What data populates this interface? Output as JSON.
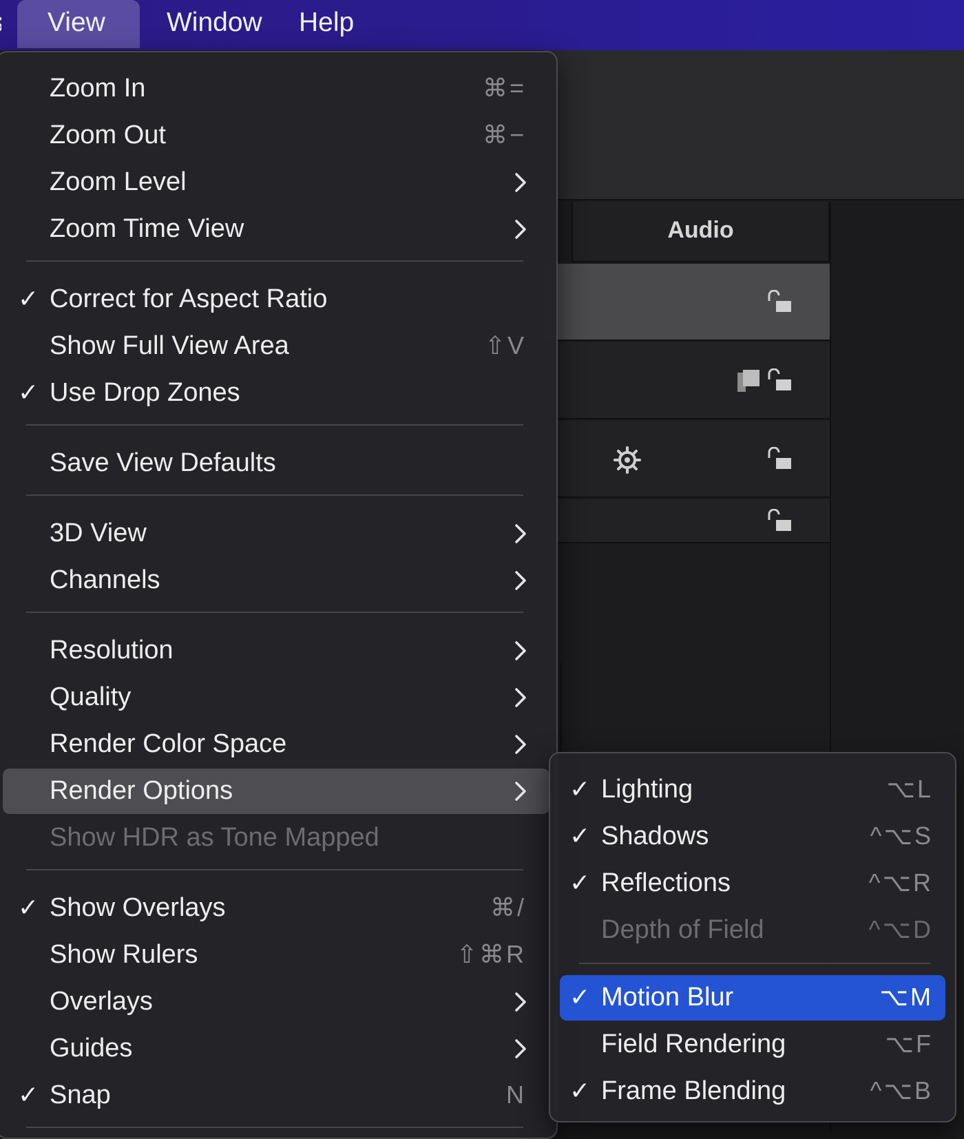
{
  "menubar": {
    "items": [
      "s",
      "View",
      "Window",
      "Help"
    ]
  },
  "background": {
    "audio_header": "Audio"
  },
  "view_menu": {
    "items": [
      {
        "label": "Zoom In",
        "shortcut": "⌘=",
        "checked": false,
        "submenu": false
      },
      {
        "label": "Zoom Out",
        "shortcut": "⌘−",
        "checked": false,
        "submenu": false
      },
      {
        "label": "Zoom Level",
        "shortcut": "",
        "checked": false,
        "submenu": true
      },
      {
        "label": "Zoom Time View",
        "shortcut": "",
        "checked": false,
        "submenu": true
      },
      {
        "label": "Correct for Aspect Ratio",
        "shortcut": "",
        "checked": true,
        "submenu": false
      },
      {
        "label": "Show Full View Area",
        "shortcut": "⇧V",
        "checked": false,
        "submenu": false
      },
      {
        "label": "Use Drop Zones",
        "shortcut": "",
        "checked": true,
        "submenu": false
      },
      {
        "label": "Save View Defaults",
        "shortcut": "",
        "checked": false,
        "submenu": false
      },
      {
        "label": "3D View",
        "shortcut": "",
        "checked": false,
        "submenu": true
      },
      {
        "label": "Channels",
        "shortcut": "",
        "checked": false,
        "submenu": true
      },
      {
        "label": "Resolution",
        "shortcut": "",
        "checked": false,
        "submenu": true
      },
      {
        "label": "Quality",
        "shortcut": "",
        "checked": false,
        "submenu": true
      },
      {
        "label": "Render Color Space",
        "shortcut": "",
        "checked": false,
        "submenu": true
      },
      {
        "label": "Render Options",
        "shortcut": "",
        "checked": false,
        "submenu": true,
        "state": "hover"
      },
      {
        "label": "Show HDR as Tone Mapped",
        "shortcut": "",
        "checked": false,
        "submenu": false,
        "state": "disabled"
      },
      {
        "label": "Show Overlays",
        "shortcut": "⌘/",
        "checked": true,
        "submenu": false
      },
      {
        "label": "Show Rulers",
        "shortcut": "⇧⌘R",
        "checked": false,
        "submenu": false
      },
      {
        "label": "Overlays",
        "shortcut": "",
        "checked": false,
        "submenu": true
      },
      {
        "label": "Guides",
        "shortcut": "",
        "checked": false,
        "submenu": true
      },
      {
        "label": "Snap",
        "shortcut": "N",
        "checked": true,
        "submenu": false
      }
    ]
  },
  "render_options_menu": {
    "items": [
      {
        "label": "Lighting",
        "shortcut": "⌥L",
        "checked": true
      },
      {
        "label": "Shadows",
        "shortcut": "^⌥S",
        "checked": true
      },
      {
        "label": "Reflections",
        "shortcut": "^⌥R",
        "checked": true
      },
      {
        "label": "Depth of Field",
        "shortcut": "^⌥D",
        "checked": false,
        "state": "disabled"
      },
      {
        "label": "Motion Blur",
        "shortcut": "⌥M",
        "checked": true,
        "state": "selected"
      },
      {
        "label": "Field Rendering",
        "shortcut": "⌥F",
        "checked": false
      },
      {
        "label": "Frame Blending",
        "shortcut": "^⌥B",
        "checked": true
      }
    ]
  },
  "colors": {
    "menubar": "#2b1d94",
    "selected": "#2453d4",
    "hover": "#4d4d52"
  }
}
